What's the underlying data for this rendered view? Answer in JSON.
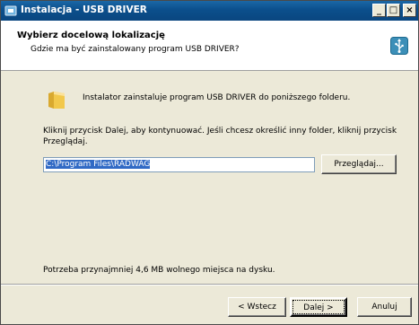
{
  "window": {
    "title": "Instalacja - USB DRIVER",
    "controls": {
      "minimize": "_",
      "maximize": "□",
      "close": "×"
    }
  },
  "header": {
    "title": "Wybierz docelową lokalizację",
    "subtitle": "Gdzie ma być zainstalowany program USB DRIVER?"
  },
  "body": {
    "intro": "Instalator zainstaluje program USB DRIVER do poniższego folderu.",
    "instructions": "Kliknij przycisk Dalej, aby kontynuować. Jeśli chcesz określić inny folder, kliknij przycisk Przeglądaj.",
    "path_value": "C:\\Program Files\\RADWAG",
    "browse_label": "Przeglądaj...",
    "space_required": "Potrzeba przynajmniej 4,6 MB wolnego miejsca na dysku."
  },
  "footer": {
    "back_label": "< Wstecz",
    "next_label": "Dalej >",
    "cancel_label": "Anuluj"
  },
  "icons": {
    "app": "installer-icon",
    "header": "usb-icon",
    "folder": "folder-icon"
  },
  "colors": {
    "titlebar": "#0b4f8c",
    "dialog_bg": "#ece9d8",
    "selection": "#316ac5"
  }
}
